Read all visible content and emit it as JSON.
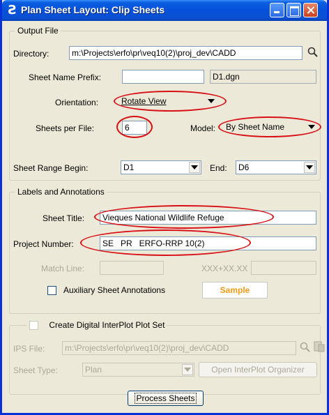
{
  "window": {
    "title": "Plan Sheet Layout: Clip Sheets"
  },
  "output_file": {
    "legend": "Output File",
    "directory_label": "Directory:",
    "directory_value": "m:\\Projects\\erfo\\pr\\veq10(2)\\proj_dev\\CADD",
    "prefix_label": "Sheet Name Prefix:",
    "prefix_value": "",
    "prefix_preview": "D1.dgn",
    "orientation_label": "Orientation:",
    "orientation_value": "Rotate View",
    "sheets_per_file_label": "Sheets per File:",
    "sheets_per_file_value": "6",
    "model_label": "Model:",
    "model_value": "By Sheet Name",
    "range_begin_label": "Sheet Range Begin:",
    "range_begin_value": "D1",
    "range_end_label": "End:",
    "range_end_value": "D6"
  },
  "labels": {
    "legend": "Labels and Annotations",
    "sheet_title_label": "Sheet Title:",
    "sheet_title_value": "Vieques National Wildlife Refuge",
    "project_number_label": "Project Number:",
    "project_number_value": "SE   PR   ERFO-RRP 10(2)",
    "match_line_label": "Match Line:",
    "match_line_value1": "",
    "match_line_middle": "XXX+XX.XX",
    "match_line_value2": "",
    "aux_annotations_label": "Auxiliary Sheet Annotations",
    "sample_label": "Sample"
  },
  "interplot": {
    "legend": "Create Digital InterPlot Plot Set",
    "ips_file_label": "IPS File:",
    "ips_file_value": "m:\\Projects\\erfo\\pr\\veq10(2)\\proj_dev\\CADD",
    "sheet_type_label": "Sheet Type:",
    "sheet_type_value": "Plan",
    "organizer_button": "Open InterPlot Organizer"
  },
  "actions": {
    "process_button": "Process Sheets"
  },
  "colors": {
    "annotation_red": "#d90f15",
    "titlebar_blue": "#0651d9",
    "sample_orange": "#f39a16"
  },
  "icons": {
    "app": "s-logo-icon",
    "browse": "magnifier-icon",
    "organizer": "organizer-icon"
  }
}
